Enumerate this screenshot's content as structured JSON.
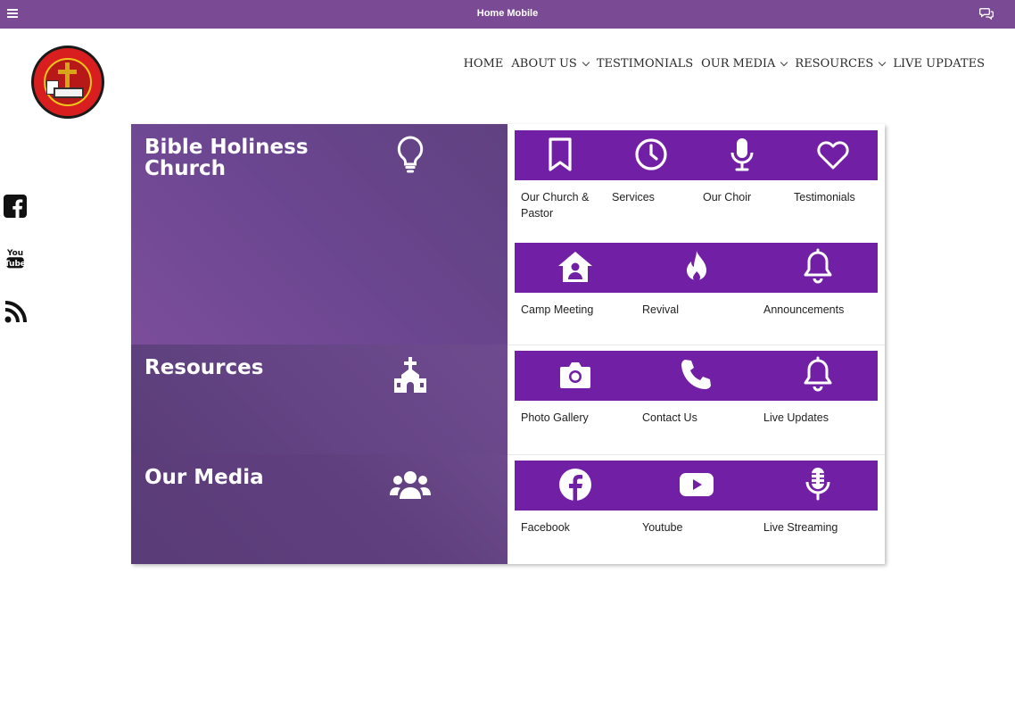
{
  "topbar": {
    "title": "Home Mobile",
    "menu_icon": "hamburger-icon",
    "chat_icon": "chat-icon"
  },
  "logo": {
    "alt": "Bible Holiness Church logo",
    "arc_text": "BIBLE HOLINESS CHURCH"
  },
  "nav": {
    "items": [
      {
        "label": "HOME",
        "has_dropdown": false
      },
      {
        "label": "ABOUT US",
        "has_dropdown": true
      },
      {
        "label": "TESTIMONIALS",
        "has_dropdown": false
      },
      {
        "label": "OUR MEDIA",
        "has_dropdown": true
      },
      {
        "label": "RESOURCES",
        "has_dropdown": true
      },
      {
        "label": "LIVE UPDATES",
        "has_dropdown": false
      }
    ]
  },
  "social": [
    {
      "icon": "facebook-icon"
    },
    {
      "icon": "youtube-icon",
      "text_top": "You",
      "text_bottom": "Tube"
    },
    {
      "icon": "rss-icon"
    }
  ],
  "colors": {
    "topbar": "#7a4a94",
    "tile_band": "#7120a6",
    "panel_purple": "#6b4690"
  },
  "sections": [
    {
      "title": "Bible Holiness Church",
      "icon": "lightbulb-icon",
      "rows": [
        {
          "tiles": [
            {
              "label": "Our Church & Pastor",
              "icon": "bookmark-icon"
            },
            {
              "label": "Services",
              "icon": "clock-icon"
            },
            {
              "label": "Our Choir",
              "icon": "microphone-icon"
            },
            {
              "label": "Testimonials",
              "icon": "heart-icon"
            }
          ]
        },
        {
          "tiles": [
            {
              "label": "Camp Meeting",
              "icon": "house-user-icon"
            },
            {
              "label": "Revival",
              "icon": "fire-icon"
            },
            {
              "label": "Announcements",
              "icon": "bell-icon"
            }
          ]
        }
      ]
    },
    {
      "title": "Resources",
      "icon": "church-icon",
      "rows": [
        {
          "tiles": [
            {
              "label": "Photo Gallery",
              "icon": "camera-icon"
            },
            {
              "label": "Contact Us",
              "icon": "phone-icon"
            },
            {
              "label": "Live Updates",
              "icon": "bell-icon"
            }
          ]
        }
      ]
    },
    {
      "title": "Our Media",
      "icon": "users-icon",
      "rows": [
        {
          "tiles": [
            {
              "label": "Facebook",
              "icon": "facebook-icon"
            },
            {
              "label": "Youtube",
              "icon": "youtube-icon"
            },
            {
              "label": "Live Streaming",
              "icon": "podcast-mic-icon"
            }
          ]
        }
      ]
    }
  ]
}
